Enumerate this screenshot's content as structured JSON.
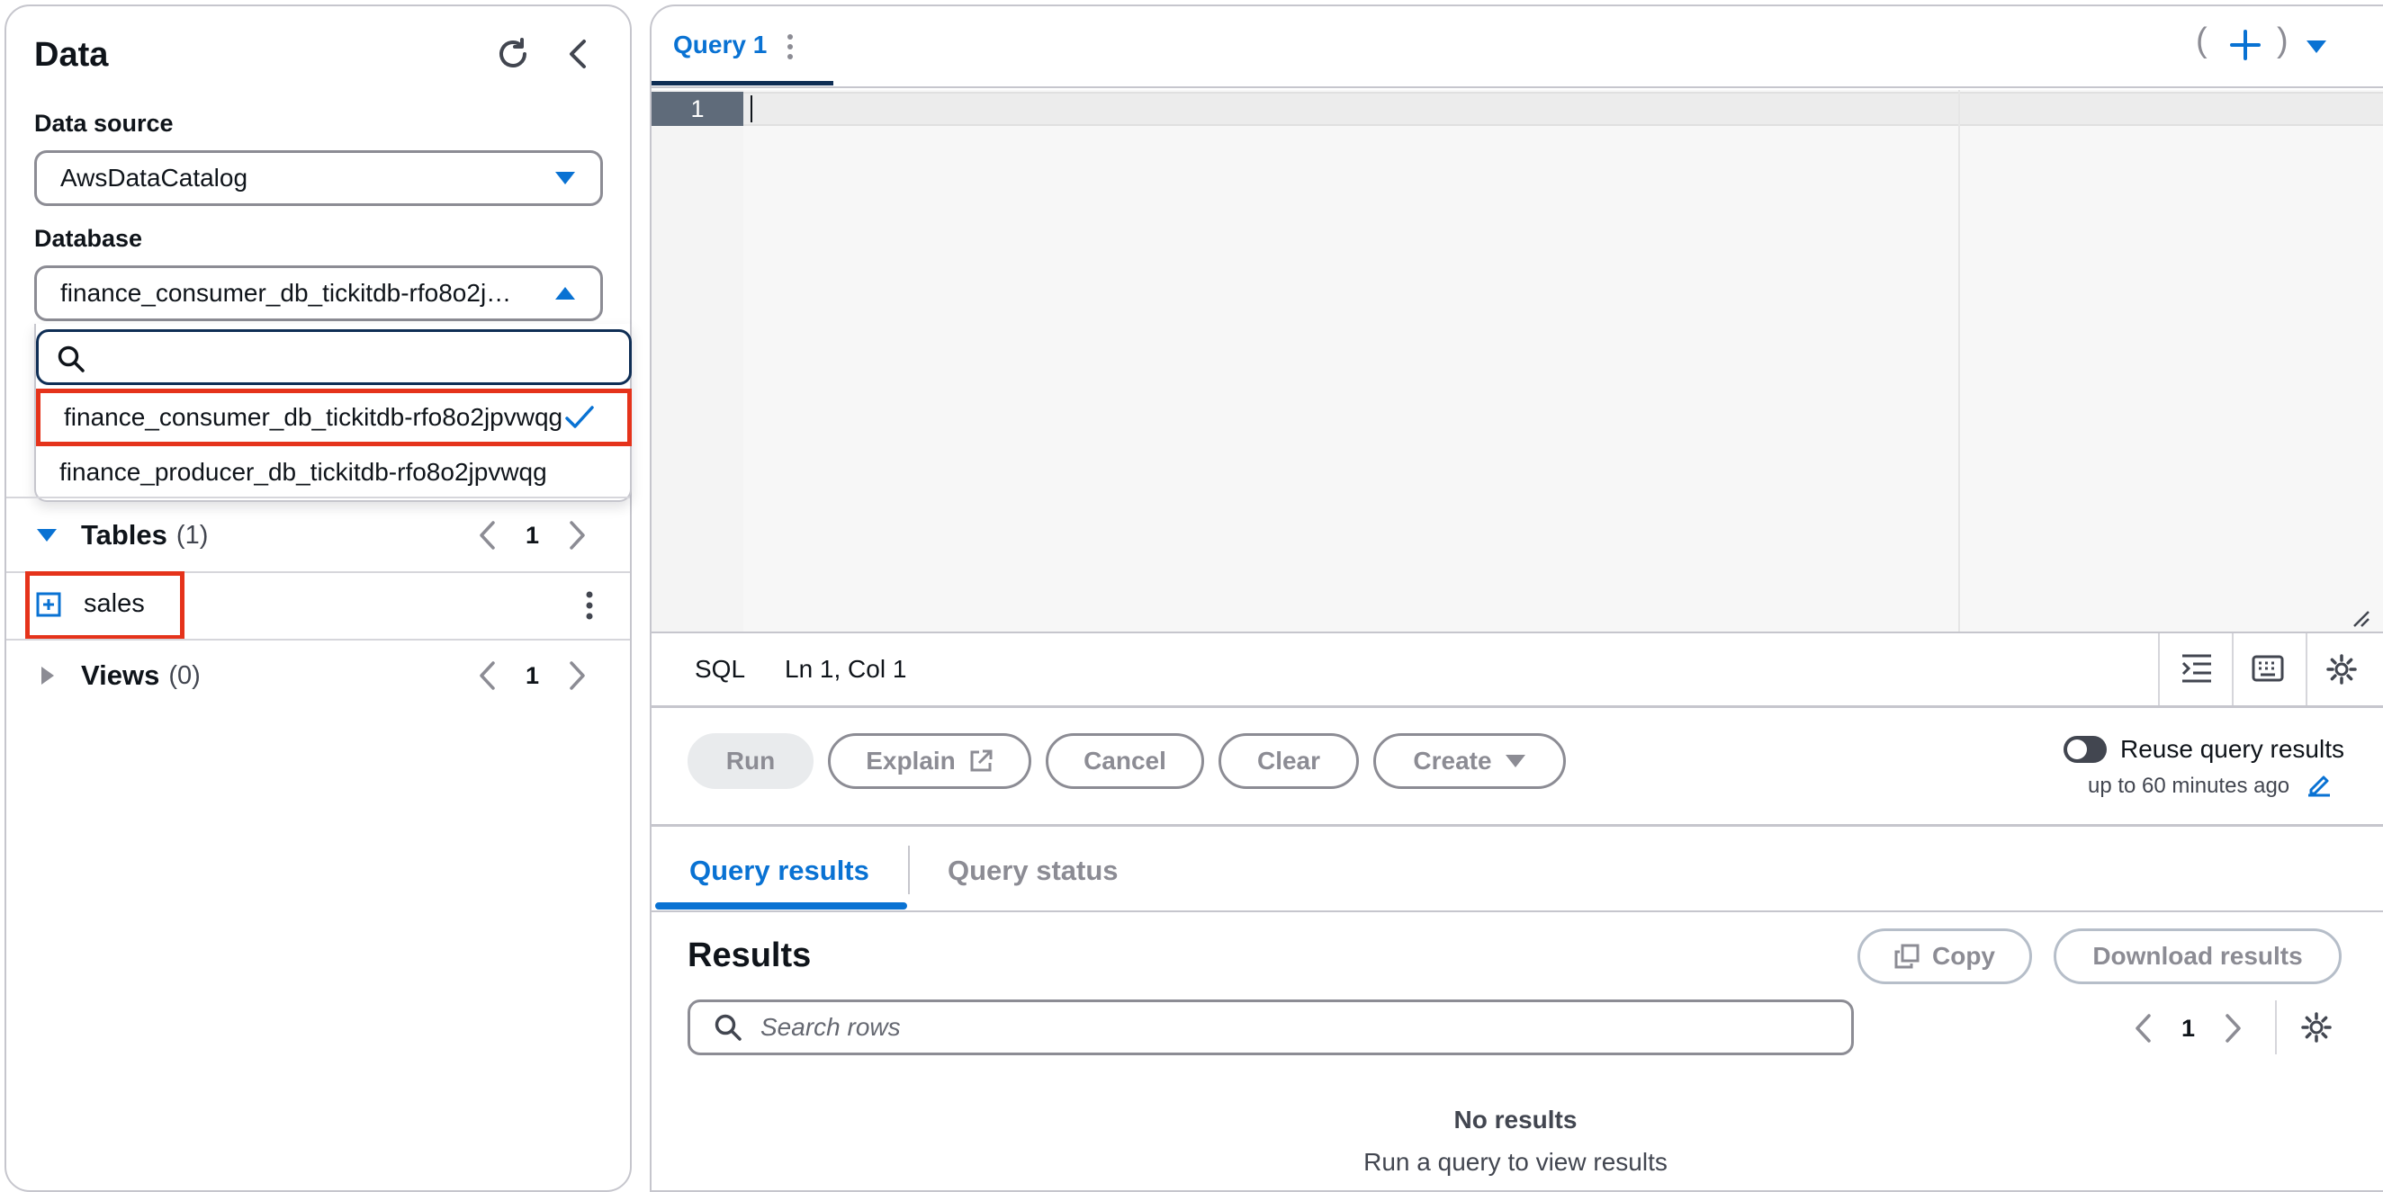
{
  "data_panel": {
    "title": "Data",
    "data_source_label": "Data source",
    "data_source_value": "AwsDataCatalog",
    "database_label": "Database",
    "database_value": "finance_consumer_db_tickitdb-rfo8o2j…",
    "database_options": [
      "finance_consumer_db_tickitdb-rfo8o2jpvwqg",
      "finance_producer_db_tickitdb-rfo8o2jpvwqg"
    ],
    "tables": {
      "label": "Tables",
      "count": "(1)",
      "page": "1",
      "items": [
        "sales"
      ]
    },
    "views": {
      "label": "Views",
      "count": "(0)",
      "page": "1"
    }
  },
  "editor": {
    "tab_label": "Query 1",
    "paren_open": "(",
    "paren_close": ")",
    "line_number": "1",
    "language": "SQL",
    "cursor_position": "Ln 1, Col 1"
  },
  "actions": {
    "run": "Run",
    "explain": "Explain",
    "cancel": "Cancel",
    "clear": "Clear",
    "create": "Create",
    "reuse_label": "Reuse query results",
    "reuse_sub": "up to 60 minutes ago"
  },
  "results": {
    "tabs": [
      "Query results",
      "Query status"
    ],
    "title": "Results",
    "copy": "Copy",
    "download": "Download results",
    "search_placeholder": "Search rows",
    "page": "1",
    "empty_title": "No results",
    "empty_sub": "Run a query to view results"
  },
  "colors": {
    "accent": "#0972d3",
    "highlight": "#e5331b",
    "border": "#8c8c94"
  }
}
